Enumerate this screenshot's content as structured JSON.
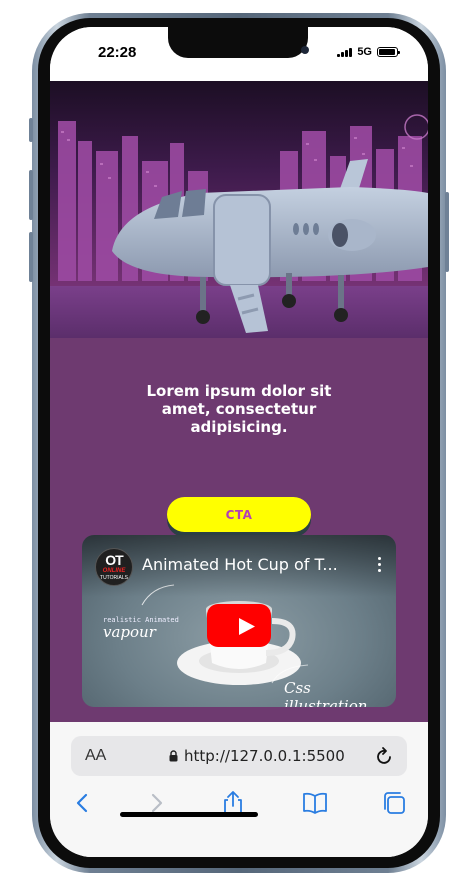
{
  "status": {
    "time": "22:28",
    "network": "5G"
  },
  "page": {
    "headline": "Lorem ipsum dolor sit amet, consectetur adipisicing.",
    "cta_label": "CTA"
  },
  "video": {
    "title": "Animated Hot Cup of T...",
    "channel_logo": {
      "ot": "OT",
      "online": "ONLINE",
      "tutorials": "TUTORIALS"
    },
    "annotation_small": "realistic Animated",
    "annotation_vapour": "vapour",
    "annotation_css": "Css illustration"
  },
  "browser": {
    "text_size_label": "AA",
    "url": "http://127.0.0.1:5500"
  },
  "icons": {
    "back": "chevron-left-icon",
    "forward": "chevron-right-icon",
    "share": "share-icon",
    "bookmarks": "book-icon",
    "tabs": "tabs-icon",
    "lock": "lock-icon",
    "reload": "reload-icon",
    "play": "play-icon"
  },
  "colors": {
    "section_bg": "#6e3a70",
    "cta_bg": "#ffff00",
    "cta_text": "#b13fb8",
    "play_red": "#ff0000",
    "ios_blue": "#2a7de1"
  }
}
